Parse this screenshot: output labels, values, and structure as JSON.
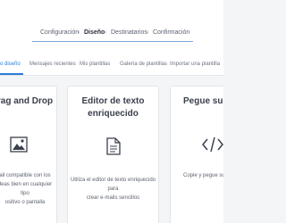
{
  "breadcrumb": {
    "step1": "Configuración",
    "step2": "Diseño",
    "step3": "Destinatarios",
    "step4": "Confirmación",
    "separator": "›"
  },
  "tabs": [
    {
      "label": "o diseño",
      "active": true
    },
    {
      "label": "Mensajes recientes",
      "active": false
    },
    {
      "label": "Mis plantillas",
      "active": false
    },
    {
      "label": "Galería de plantillas",
      "active": false
    },
    {
      "label": "Importar una plantilla",
      "active": false
    }
  ],
  "cards": [
    {
      "title": "rag and Drop",
      "desc": "ail compatible con los\ndeas bien en cualquier tipo\nositivo o pantalla",
      "icon": "image-icon"
    },
    {
      "title": "Editor de texto\nenriquecido",
      "desc": "Utiliza el editor de texto enriquecido para\ncrear e-mails sencillos",
      "icon": "document-icon"
    },
    {
      "title": "Pegue su c",
      "desc": "Copie y pegue su c",
      "icon": "code-icon"
    }
  ],
  "colors": {
    "accent": "#2f7ad6",
    "background": "#f4f5f7"
  }
}
